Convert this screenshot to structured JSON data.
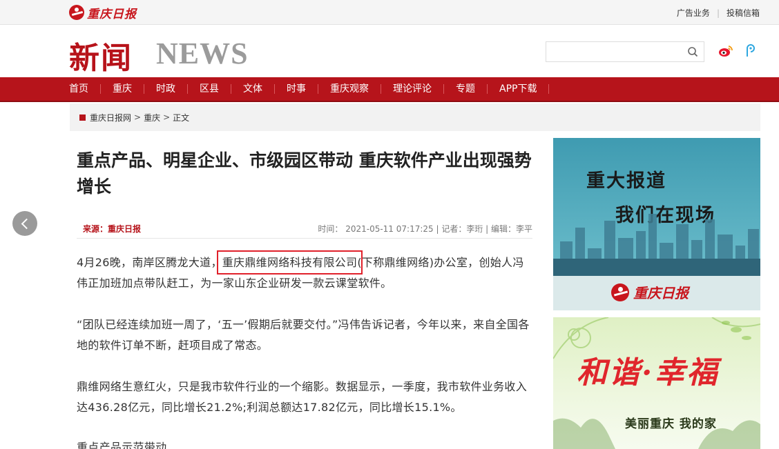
{
  "top": {
    "logo_text": "重庆日报",
    "links": [
      "广告业务",
      "投稿信箱"
    ]
  },
  "header": {
    "brand_cn": "新闻",
    "brand_en": "NEWS",
    "search_value": "",
    "search_placeholder": ""
  },
  "nav": {
    "items": [
      "首页",
      "重庆",
      "时政",
      "区县",
      "文体",
      "时事",
      "重庆观察",
      "理论评论",
      "专题",
      "APP下载"
    ]
  },
  "breadcrumb": {
    "items": [
      "重庆日报网",
      "重庆",
      "正文"
    ],
    "separator": ">"
  },
  "article": {
    "title": "重点产品、明星企业、市级园区带动 重庆软件产业出现强势增长",
    "source": "来源：重庆日报",
    "meta": "时间： 2021-05-11 07:17:25 | 记者：李珩 | 编辑：李平",
    "p1_before": "4月26晚，南岸区腾龙大道，",
    "p1_highlight": "重庆鼎维网络科技有限公司",
    "p1_after": "(下称鼎维网络)办公室，创始人冯伟正加班加点带队赶工，为一家山东企业研发一款云课堂软件。",
    "p2": "“团队已经连续加班一周了，‘五一’假期后就要交付。”冯伟告诉记者，今年以来，来自全国各地的软件订单不断，赶项目成了常态。",
    "p3": "鼎维网络生意红火，只是我市软件行业的一个缩影。数据显示，一季度，我市软件业务收入达436.28亿元，同比增长21.2%;利润总额达17.82亿元，同比增长15.1%。",
    "p4": "重点产品示范带动"
  },
  "banners": {
    "ad1_line1": "重大报道",
    "ad1_line2": "我们在现场",
    "ad1_logo": "重庆日报",
    "ad2_art": "和谐·幸福",
    "ad2_sub": "美丽重庆 我的家"
  },
  "colors": {
    "brand_red": "#b6141b",
    "highlight_red": "#e0202a"
  }
}
